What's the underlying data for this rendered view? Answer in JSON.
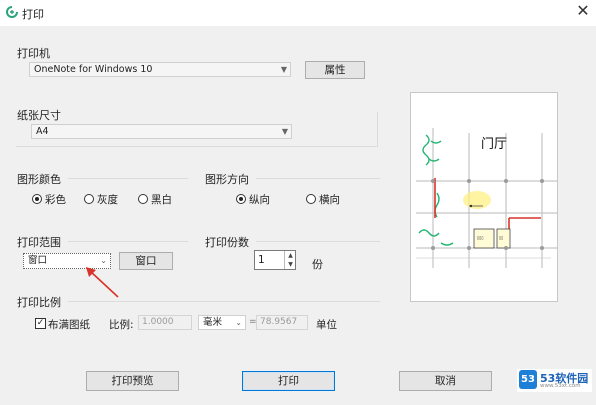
{
  "window": {
    "title": "打印",
    "close_glyph": "✕"
  },
  "printer": {
    "label": "打印机",
    "selected": "OneNote for Windows 10",
    "properties_button": "属性"
  },
  "paper": {
    "label": "纸张尺寸",
    "selected": "A4"
  },
  "color": {
    "label": "图形颜色",
    "options": [
      "彩色",
      "灰度",
      "黑白"
    ],
    "selected": "彩色"
  },
  "orientation": {
    "label": "图形方向",
    "options": [
      "纵向",
      "横向"
    ],
    "selected": "纵向"
  },
  "range": {
    "label": "打印范围",
    "selected": "窗口",
    "window_button": "窗口"
  },
  "copies": {
    "label": "打印份数",
    "value": "1",
    "unit": "份"
  },
  "scale": {
    "label": "打印比例",
    "fit_label": "布满图纸",
    "fit_checked": true,
    "ratio_label": "比例:",
    "ratio_value": "1.0000",
    "unit_selected": "毫米",
    "equals": "=",
    "unit_value": "78.9567",
    "units_label": "单位"
  },
  "preview": {
    "room_label": "门厅"
  },
  "footer": {
    "preview_button": "打印预览",
    "print_button": "打印",
    "cancel_button": "取消"
  },
  "watermark": {
    "logo": "53",
    "text": "53软件园",
    "sub": "www.53xt.com"
  },
  "colors": {
    "accent": "#0078d7",
    "annotation_arrow": "#d9342b"
  }
}
